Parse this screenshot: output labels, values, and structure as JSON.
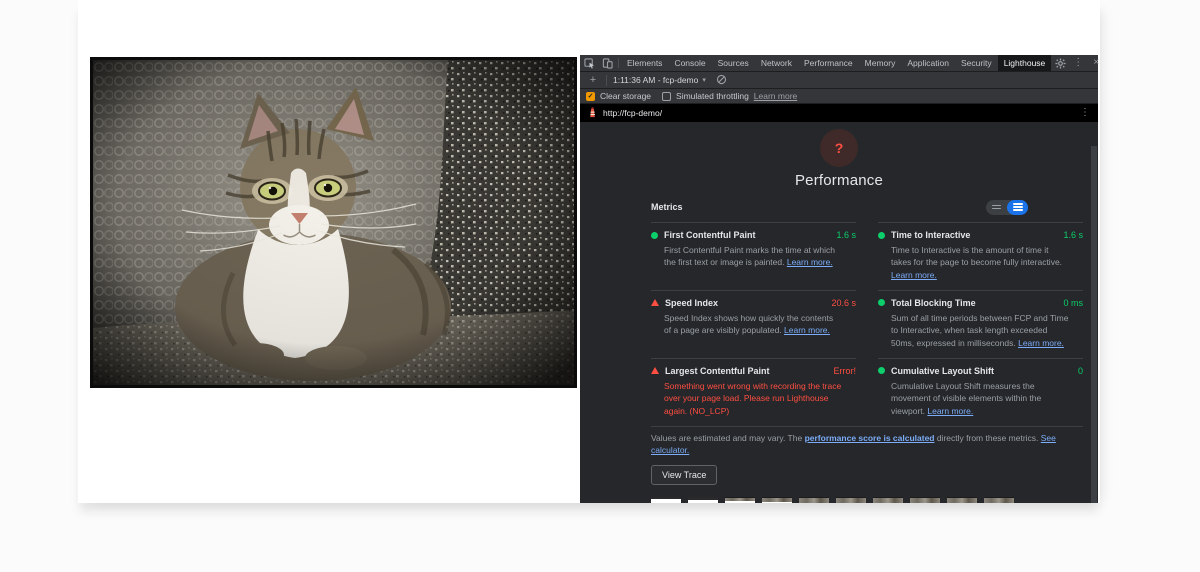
{
  "devtools": {
    "toolbar": {
      "tabs": [
        {
          "label": "Elements"
        },
        {
          "label": "Console"
        },
        {
          "label": "Sources"
        },
        {
          "label": "Network"
        },
        {
          "label": "Performance"
        },
        {
          "label": "Memory"
        },
        {
          "label": "Application"
        },
        {
          "label": "Security"
        },
        {
          "label": "Lighthouse",
          "active": true
        }
      ],
      "kebab_glyph": "⋮",
      "close_glyph": "×"
    },
    "run_bar": {
      "add_glyph": "+",
      "run_selector": "1:11:36 AM - fcp-demo",
      "dropdown_glyph": "▾"
    },
    "settings_bar": {
      "clear_storage": {
        "label": "Clear storage",
        "checked": true,
        "check_glyph": "✓"
      },
      "simulated_throttling": {
        "label": "Simulated throttling",
        "checked": false
      },
      "learn_more": "Learn more"
    },
    "url_bar": {
      "url": "http://fcp-demo/"
    }
  },
  "report": {
    "gauge": {
      "glyph": "?"
    },
    "title": "Performance",
    "metrics_section": {
      "header": "Metrics",
      "metrics": [
        {
          "title": "First Contentful Paint",
          "status": "pass",
          "value": "1.6 s",
          "desc": "First Contentful Paint marks the time at which the first text or image is painted.",
          "link": "Learn more."
        },
        {
          "title": "Time to Interactive",
          "status": "pass",
          "value": "1.6 s",
          "desc": "Time to Interactive is the amount of time it takes for the page to become fully interactive.",
          "link": "Learn more."
        },
        {
          "title": "Speed Index",
          "status": "fail",
          "value": "20.6 s",
          "desc": "Speed Index shows how quickly the contents of a page are visibly populated.",
          "link": "Learn more."
        },
        {
          "title": "Total Blocking Time",
          "status": "pass",
          "value": "0 ms",
          "desc": "Sum of all time periods between FCP and Time to Interactive, when task length exceeded 50ms, expressed in milliseconds.",
          "link": "Learn more."
        },
        {
          "title": "Largest Contentful Paint",
          "status": "fail",
          "value": "Error!",
          "error_desc": "Something went wrong with recording the trace over your page load. Please run Lighthouse again. (NO_LCP)"
        },
        {
          "title": "Cumulative Layout Shift",
          "status": "pass",
          "value": "0",
          "desc": "Cumulative Layout Shift measures the movement of visible elements within the viewport.",
          "link": "Learn more."
        }
      ]
    },
    "footer": {
      "pre": "Values are estimated and may vary. The ",
      "link1": "performance score is calculated",
      "mid": " directly from these metrics. ",
      "link2": "See calculator."
    },
    "view_trace_label": "View Trace",
    "filmstrip": {
      "frames": [
        {
          "photo_height": 2
        },
        {
          "photo_height": 3
        },
        {
          "photo_height": 4
        },
        {
          "photo_height": 5
        },
        {
          "photo_height": 7
        },
        {
          "photo_height": 8
        },
        {
          "photo_height": 9
        },
        {
          "photo_height": 10
        },
        {
          "photo_height": 12
        },
        {
          "photo_height": 14
        }
      ]
    }
  },
  "colors": {
    "pass_green": "#0cce6b",
    "fail_red": "#ff4e42",
    "link_blue": "#7cacf8",
    "accent_blue": "#1a73e8",
    "checkbox_orange": "#f29900",
    "devtools_bg": "#25272a",
    "toolbar_bg": "#35363a"
  }
}
